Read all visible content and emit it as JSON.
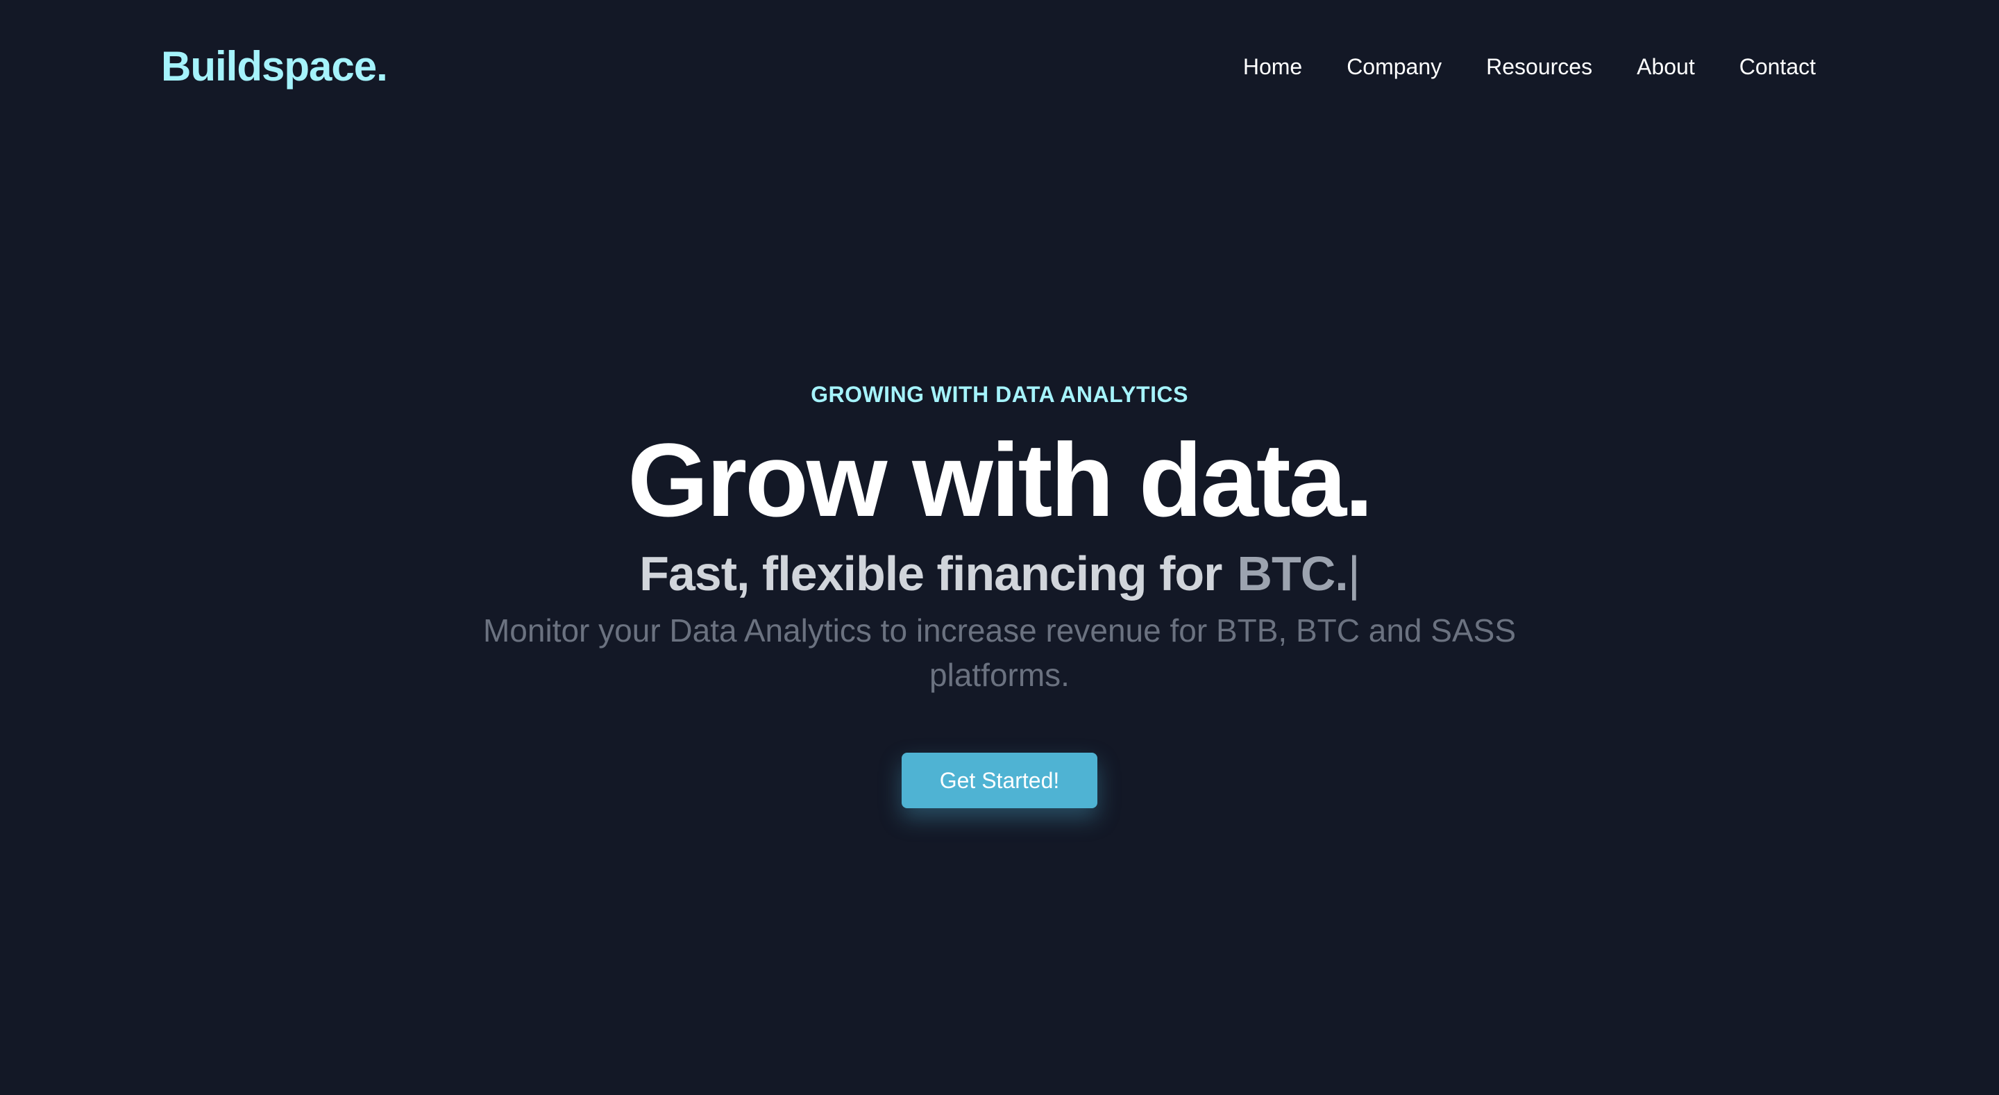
{
  "nav": {
    "logo": "Buildspace.",
    "links": [
      "Home",
      "Company",
      "Resources",
      "About",
      "Contact"
    ]
  },
  "hero": {
    "eyebrow": "GROWING WITH DATA ANALYTICS",
    "headline": "Grow with data.",
    "subheadline_prefix": "Fast, flexible financing for",
    "subheadline_typed": "BTC.",
    "typing_cursor": "|",
    "description": "Monitor your Data Analytics to increase revenue for BTB, BTC and SASS platforms.",
    "cta_label": "Get Started!"
  },
  "colors": {
    "background": "#131826",
    "accent": "#a5f3fc",
    "button": "#4fb3d3",
    "heading": "#ffffff",
    "subheading": "#d1d5db",
    "muted": "#6b7280"
  }
}
